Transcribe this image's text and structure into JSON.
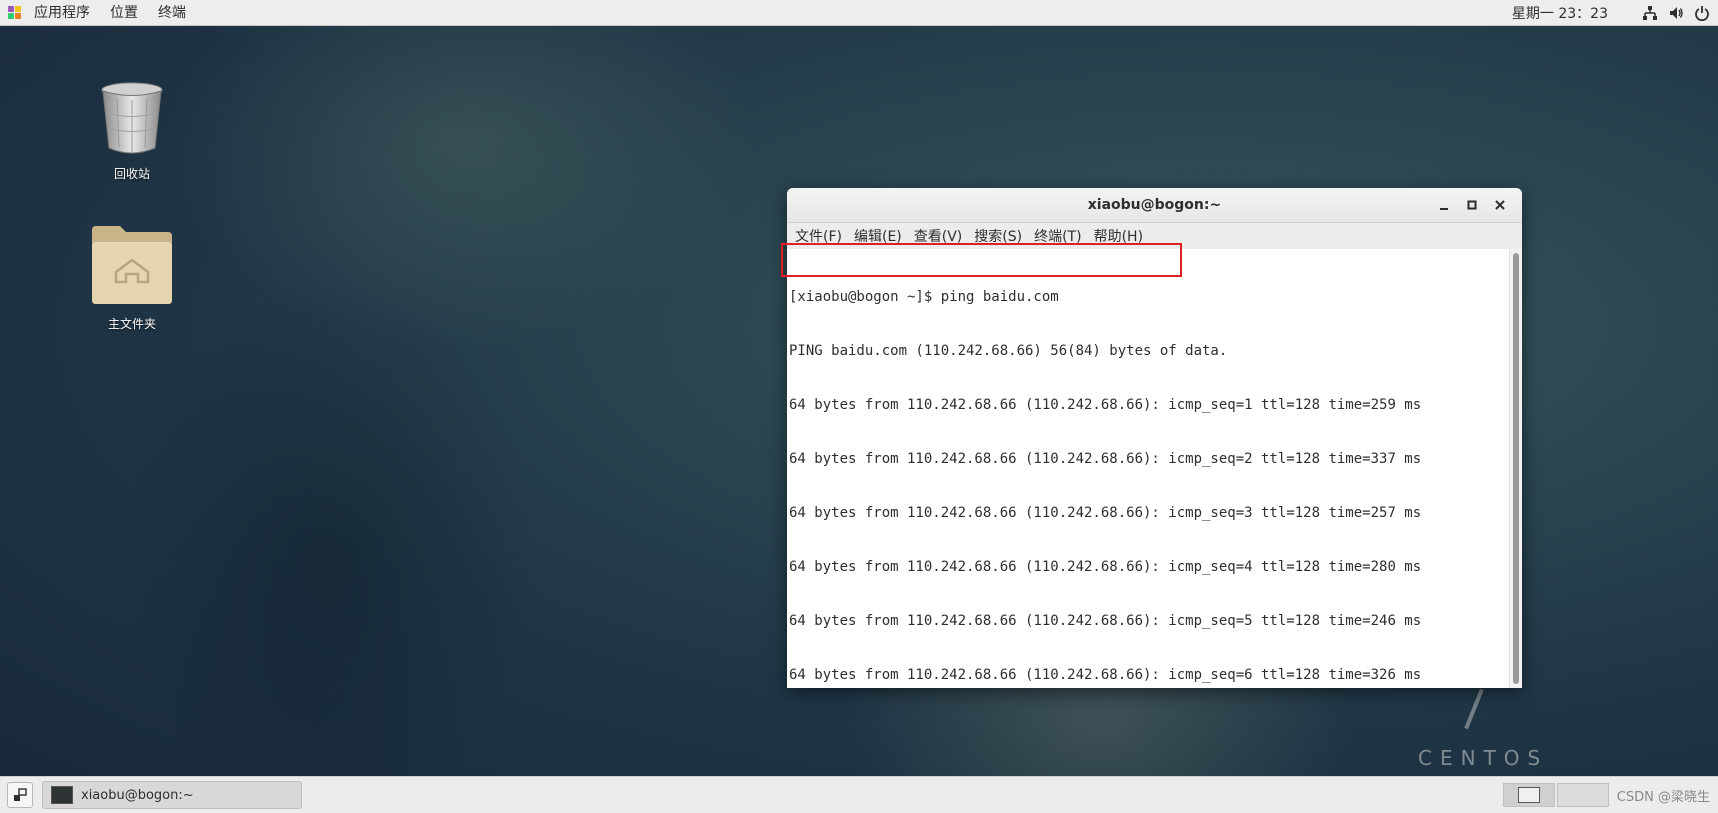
{
  "topbar": {
    "menus": [
      "应用程序",
      "位置",
      "终端"
    ],
    "clock": "星期一 23：23"
  },
  "desktop": {
    "trash_label": "回收站",
    "home_label": "主文件夹",
    "brand": "CENTOS"
  },
  "window": {
    "title": "xiaobu@bogon:~",
    "menus": [
      "文件(F)",
      "编辑(E)",
      "查看(V)",
      "搜索(S)",
      "终端(T)",
      "帮助(H)"
    ],
    "lines": [
      "[xiaobu@bogon ~]$ ping baidu.com",
      "PING baidu.com (110.242.68.66) 56(84) bytes of data.",
      "64 bytes from 110.242.68.66 (110.242.68.66): icmp_seq=1 ttl=128 time=259 ms",
      "64 bytes from 110.242.68.66 (110.242.68.66): icmp_seq=2 ttl=128 time=337 ms",
      "64 bytes from 110.242.68.66 (110.242.68.66): icmp_seq=3 ttl=128 time=257 ms",
      "64 bytes from 110.242.68.66 (110.242.68.66): icmp_seq=4 ttl=128 time=280 ms",
      "64 bytes from 110.242.68.66 (110.242.68.66): icmp_seq=5 ttl=128 time=246 ms",
      "64 bytes from 110.242.68.66 (110.242.68.66): icmp_seq=6 ttl=128 time=326 ms"
    ]
  },
  "taskbar": {
    "task_label": "xiaobu@bogon:~",
    "watermark": "CSDN @梁晓生"
  },
  "colors": {
    "highlight": "#e02020",
    "terminal_text": "#2e2e2e"
  }
}
